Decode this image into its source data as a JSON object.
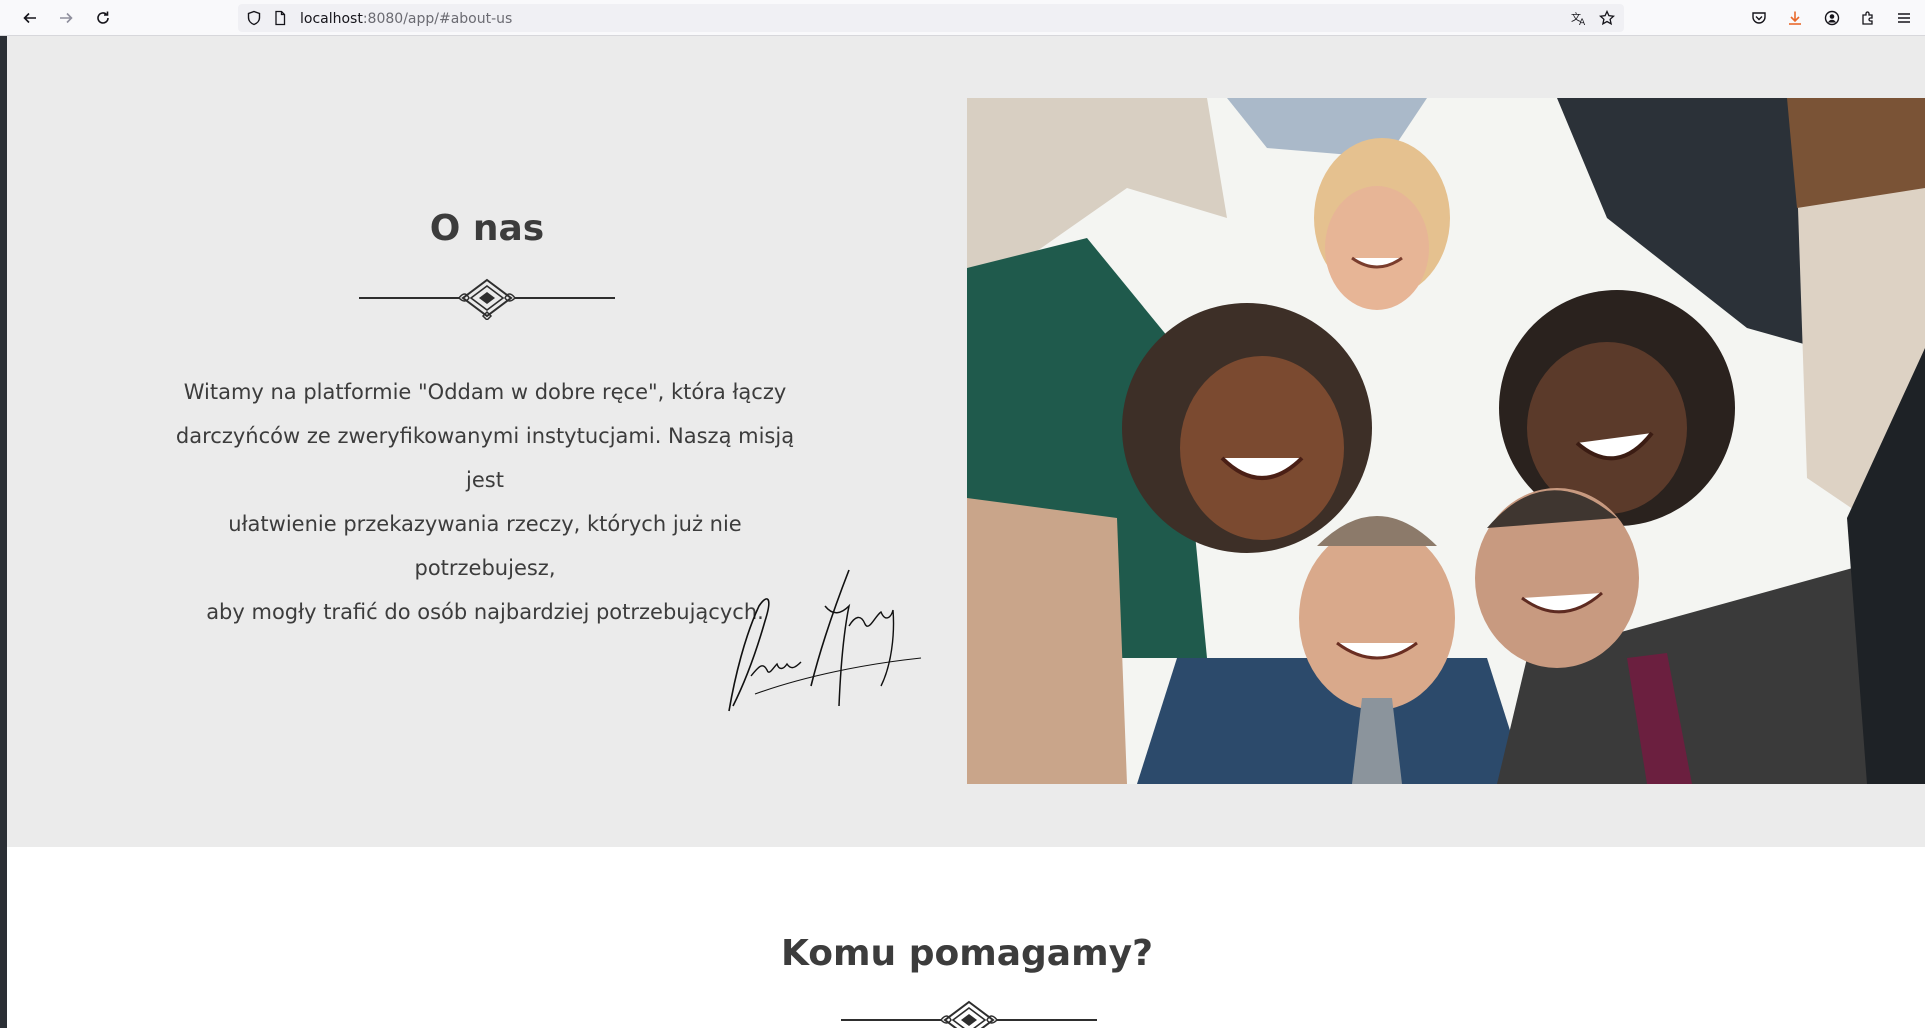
{
  "browser": {
    "url_host": "localhost",
    "url_rest": ":8080/app/#about-us"
  },
  "about": {
    "title": "O nas",
    "text": "Witamy na platformie \"Oddam w dobre ręce\", która łączy darczyńców ze zweryfikowanymi instytucjami. Naszą misją jest ułatwienie przekazywania rzeczy, których już nie potrzebujesz, aby mogły trafić do osób najbardziej potrzebujących.",
    "text_lines": [
      "Witamy na platformie \"Oddam w dobre ręce\", która łączy",
      "darczyńców ze zweryfikowanymi instytucjami. Naszą misją jest",
      "ułatwienie przekazywania rzeczy, których już nie potrzebujesz,",
      "aby mogły trafić do osób najbardziej potrzebujących."
    ]
  },
  "help": {
    "title": "Komu pomagamy?"
  },
  "colors": {
    "about_bg": "#ebebeb",
    "heading": "#3c3c3c",
    "download_icon": "#e8692c"
  }
}
